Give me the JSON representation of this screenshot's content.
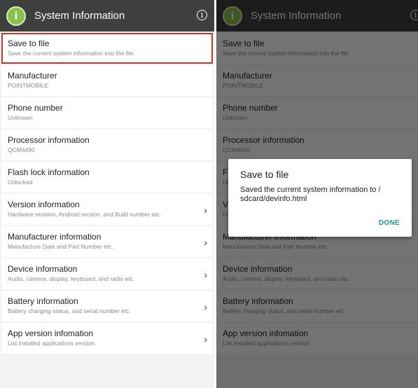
{
  "app": {
    "title": "System Information",
    "icon_glyph": "i",
    "info_glyph": "i",
    "accent": "#8bc34a"
  },
  "items": [
    {
      "title": "Save to file",
      "subtitle": "Save the current system information into the file.",
      "chevron": ""
    },
    {
      "title": "Manufacturer",
      "subtitle": "POINTMOBILE",
      "chevron": ""
    },
    {
      "title": "Phone number",
      "subtitle": "Unknown",
      "chevron": ""
    },
    {
      "title": "Processor information",
      "subtitle": "QCM4490",
      "chevron": ""
    },
    {
      "title": "Flash lock information",
      "subtitle": "Unlocked",
      "chevron": ""
    },
    {
      "title": "Version information",
      "subtitle": "Hardware revision, Android version, and Build number etc.",
      "chevron": "›"
    },
    {
      "title": "Manufacturer information",
      "subtitle": "Manufacture Date and Part Number etc.",
      "chevron": "›"
    },
    {
      "title": "Device information",
      "subtitle": "Audio, camera, display, keyboard, and radio etc.",
      "chevron": "›"
    },
    {
      "title": "Battery information",
      "subtitle": "Battery charging status, and serial number etc.",
      "chevron": "›"
    },
    {
      "title": "App version infomation",
      "subtitle": "List installed applications version.",
      "chevron": "›"
    }
  ],
  "dialog": {
    "title": "Save to file",
    "message": "Saved the current system information to / sdcard/devinfo.html",
    "button": "DONE"
  },
  "colors": {
    "selection_border": "#c0392b",
    "dialog_button": "#1e9b8a",
    "appbar": "#3f3f3f"
  }
}
